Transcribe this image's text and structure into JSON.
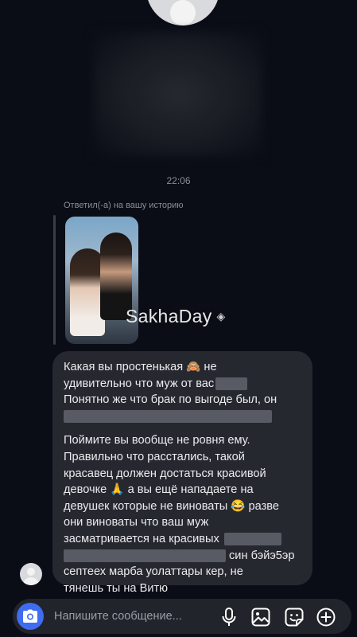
{
  "thread": {
    "timestamp": "22:06",
    "replied_label": "Ответил(-а) на вашу историю",
    "story_watermark": "SakhaDay"
  },
  "message": {
    "lines": [
      "Какая вы простенькая 🙈 не",
      "удивительно что муж от вас",
      "Понятно же что брак по выгоде был, он",
      "",
      "Поймите вы вообще не ровня ему.",
      "Правильно что расстались, такой",
      "красавец должен достаться красивой",
      "девочке 🙏 а вы ещё нападаете на",
      "девушек которые не виноваты 😂 разве",
      "они виноваты что ваш муж",
      "засматривается на красивых",
      "син бэйэ5эр",
      "септеех марба уолаттары кер, не",
      "тянешь ты на Витю"
    ]
  },
  "composer": {
    "placeholder": "Напишите сообщение..."
  },
  "icons": {
    "camera": "camera-icon",
    "mic": "microphone-icon",
    "gallery": "image-icon",
    "sticker": "sticker-icon",
    "add": "plus-icon"
  },
  "colors": {
    "background": "#0a0d16",
    "bubble": "#262830",
    "accent": "#3f6cf0"
  }
}
